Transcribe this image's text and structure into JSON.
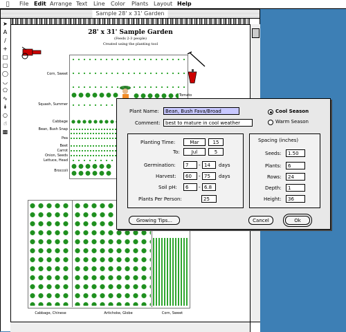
{
  "menubar": {
    "items": [
      "File",
      "Edit",
      "Arrange",
      "Text",
      "Line",
      "Color",
      "Plants",
      "Layout",
      "Help"
    ]
  },
  "window": {
    "title": "Sample 28' x 31' Garden"
  },
  "garden": {
    "title": "28' x 31' Sample Garden",
    "subtitle": "(Feeds 2-3 people)",
    "caption": "Created using the planting tool",
    "rows": [
      "Corn, Sweet",
      "Squash, Summer",
      "Tomato",
      "Cabbage",
      "Bean, Bush Snap",
      "Pea",
      "Beet",
      "Carrot",
      "Onion, Seeds",
      "Lettuce, Head",
      "Broccoli"
    ],
    "bottom_labels": [
      "Cabbage, Chinese",
      "Artichoke, Globe",
      "Corn, Sweet"
    ]
  },
  "dialog": {
    "plant_name_label": "Plant Name:",
    "plant_name": "Bean, Bush Fava/Broad",
    "comment_label": "Comment:",
    "comment": "best to mature in cool weather",
    "season_options": [
      "Cool Season",
      "Warm Season"
    ],
    "season_selected": "Cool Season",
    "planting_time_label": "Planting Time:",
    "from_month": "Mar",
    "from_day": "15",
    "to_label": "To:",
    "to_month": "Jul",
    "to_day": "5",
    "germination_label": "Germination:",
    "germination_min": "7",
    "germination_max": "14",
    "harvest_label": "Harvest:",
    "harvest_min": "60",
    "harvest_max": "75",
    "days_unit": "days",
    "soil_ph_label": "Soil pH:",
    "soil_ph_min": "6",
    "soil_ph_max": "6.8",
    "plants_per_person_label": "Plants Per Person:",
    "plants_per_person": "25",
    "spacing_title": "Spacing (inches)",
    "seeds_label": "Seeds:",
    "seeds": "1.50",
    "plants_label": "Plants:",
    "plants": "6",
    "rows_label": "Rows:",
    "rows": "24",
    "depth_label": "Depth:",
    "depth": "1",
    "height_label": "Height:",
    "height": "36",
    "growing_tips_label": "Growing Tips...",
    "cancel_label": "Cancel",
    "ok_label": "Ok",
    "dash": "-"
  },
  "colors": {
    "desktop": "#3d7fb5",
    "plant_green": "#1f8f1f",
    "highlight": "#c8c8ff"
  }
}
